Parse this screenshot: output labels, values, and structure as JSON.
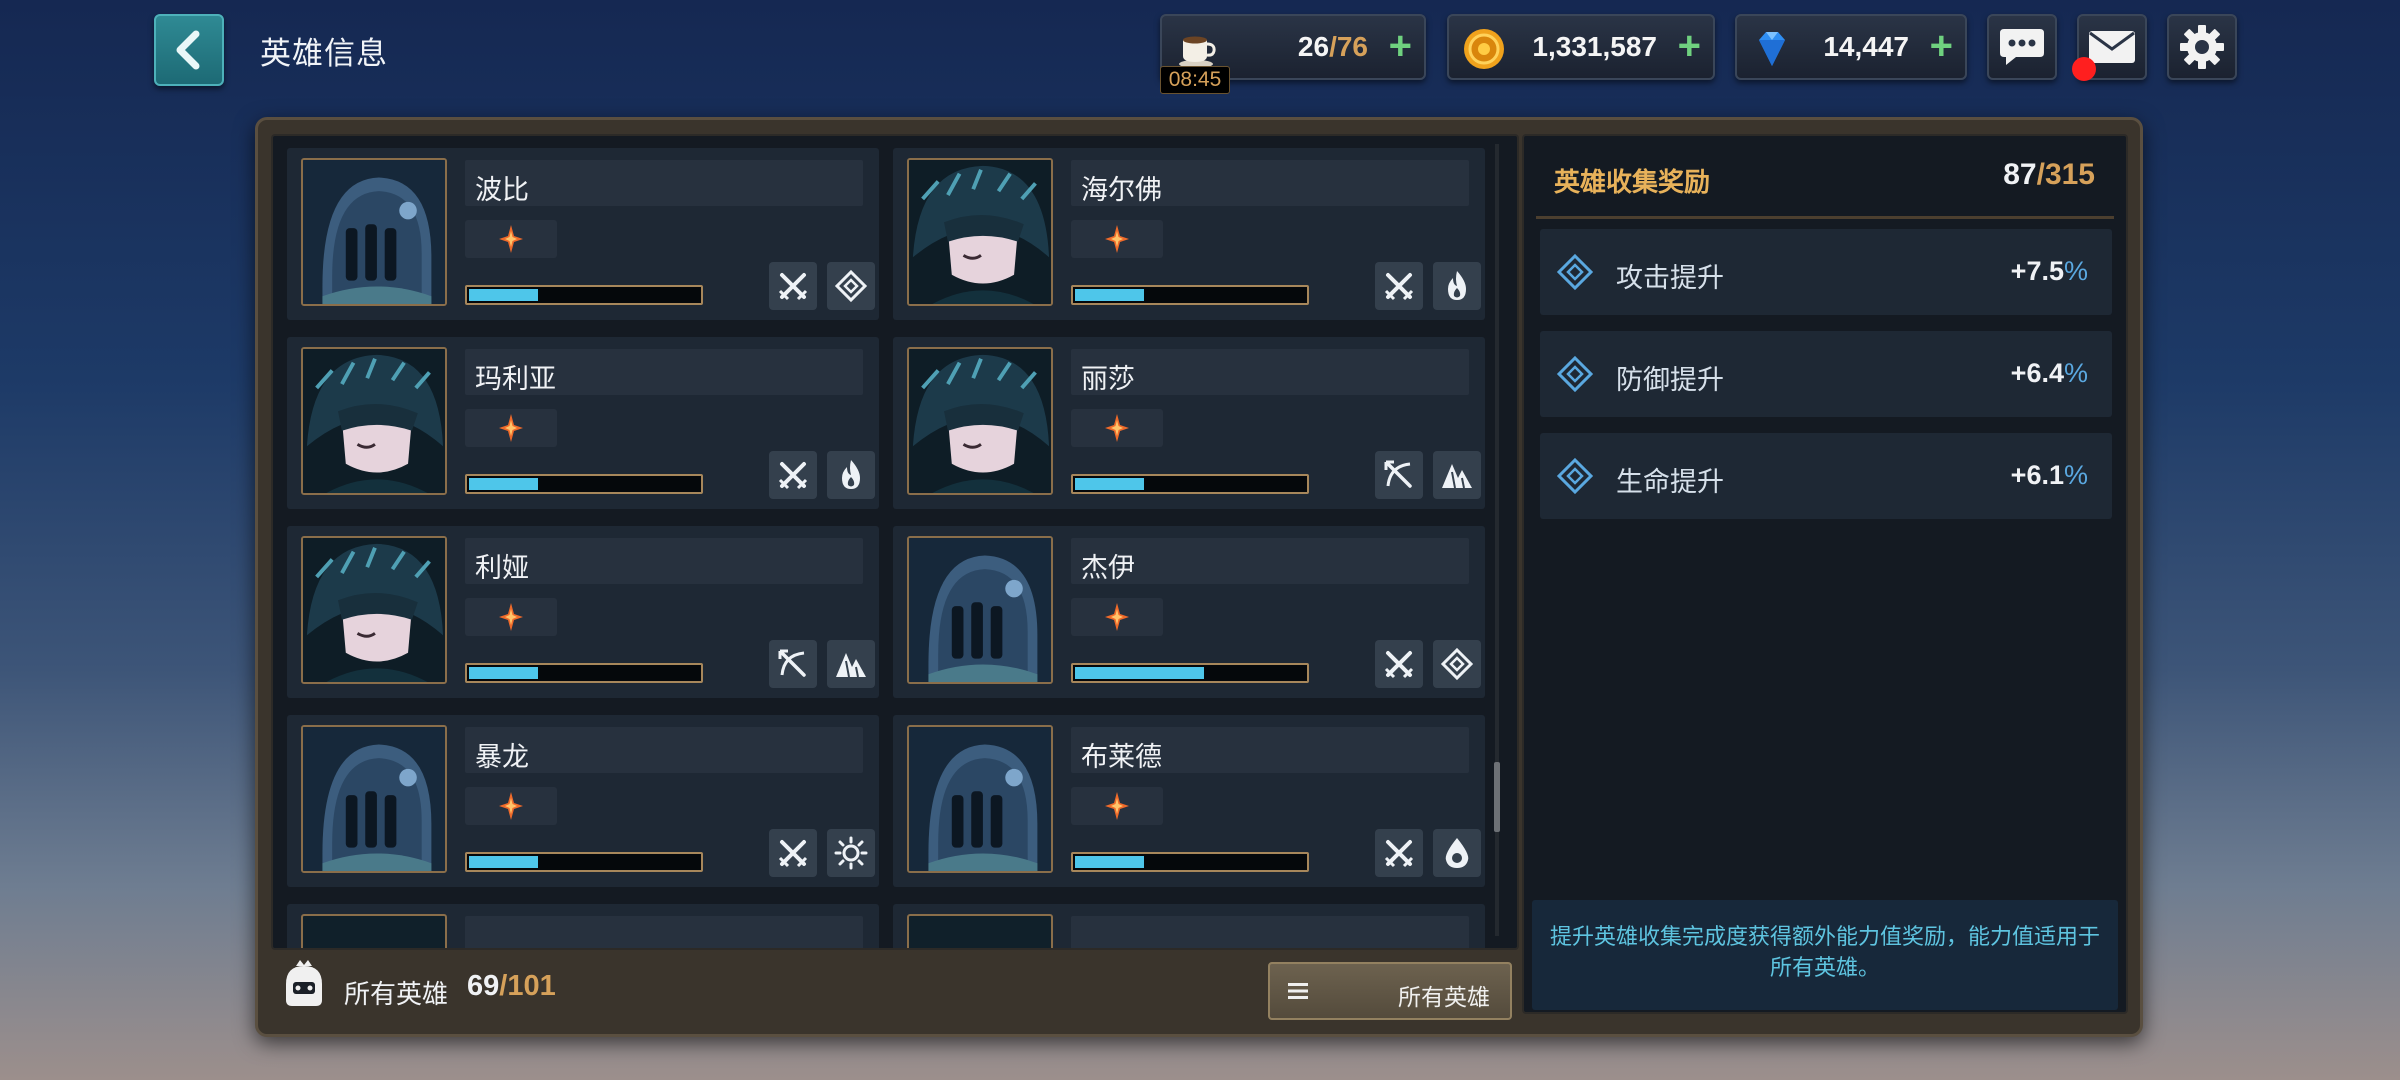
{
  "header": {
    "title": "英雄信息",
    "back_icon": "chevron-left-icon"
  },
  "resources": {
    "stamina": {
      "current": "26",
      "separator": "/",
      "max": "76",
      "timer": "08:45",
      "icon": "coffee-cup-icon"
    },
    "gold": {
      "value": "1,331,587",
      "icon": "gold-coin-icon"
    },
    "gems": {
      "value": "14,447",
      "icon": "blue-diamond-icon"
    },
    "plus": "+"
  },
  "top_buttons": [
    "chat-icon",
    "mail-icon",
    "gear-icon"
  ],
  "heroes": [
    {
      "name": "波比",
      "portrait": "knight",
      "exp": 0.3,
      "icons": [
        "crossed-swords-icon",
        "diamond-rune-icon"
      ]
    },
    {
      "name": "海尔佛",
      "portrait": "hooded",
      "exp": 0.3,
      "icons": [
        "crossed-swords-icon",
        "flame-icon"
      ]
    },
    {
      "name": "玛利亚",
      "portrait": "hooded",
      "exp": 0.3,
      "icons": [
        "crossed-swords-icon",
        "flame-icon"
      ]
    },
    {
      "name": "丽莎",
      "portrait": "hooded",
      "exp": 0.3,
      "icons": [
        "crossed-bow-icon",
        "mountain-icon"
      ]
    },
    {
      "name": "利娅",
      "portrait": "hooded",
      "exp": 0.3,
      "icons": [
        "crossed-bow-icon",
        "mountain-icon"
      ]
    },
    {
      "name": "杰伊",
      "portrait": "knight",
      "exp": 0.56,
      "icons": [
        "crossed-swords-icon",
        "diamond-rune-icon"
      ]
    },
    {
      "name": "暴龙",
      "portrait": "knight",
      "exp": 0.3,
      "icons": [
        "crossed-swords-icon",
        "sun-icon"
      ]
    },
    {
      "name": "布莱德",
      "portrait": "knight",
      "exp": 0.3,
      "icons": [
        "crossed-swords-icon",
        "water-drop-icon"
      ]
    }
  ],
  "footer": {
    "all_heroes_label": "所有英雄",
    "owned": "69",
    "separator": "/",
    "total": "101",
    "filter_label": "所有英雄"
  },
  "reward": {
    "title": "英雄收集奖励",
    "current": "87",
    "separator": "/",
    "max": "315",
    "stats": [
      {
        "label": "攻击提升",
        "value": "+7.5",
        "unit": "%"
      },
      {
        "label": "防御提升",
        "value": "+6.4",
        "unit": "%"
      },
      {
        "label": "生命提升",
        "value": "+6.1",
        "unit": "%"
      }
    ],
    "description": "提升英雄收集完成度获得额外能力值奖励，能力值适用于所有英雄。"
  },
  "colors": {
    "accent_gold": "#d6a15a",
    "exp_bar": "#4ec6ea",
    "percent_blue": "#5aa8e0",
    "description_cyan": "#5ec4e0"
  }
}
